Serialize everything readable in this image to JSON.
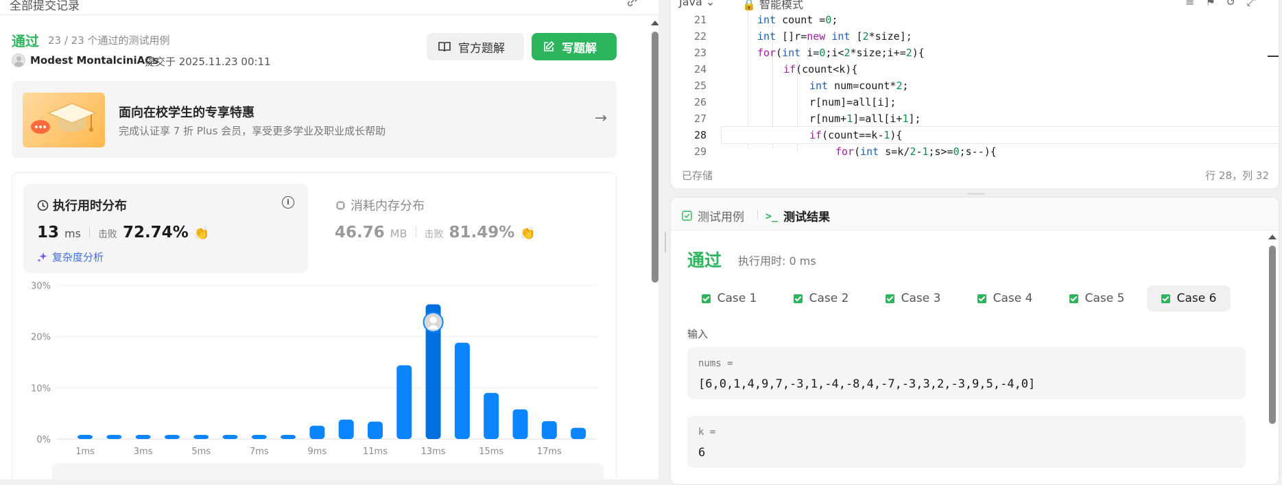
{
  "left_panel": {
    "header_title": "全部提交记录",
    "status": "通过",
    "cases_passed": "23 / 23 个通过的测试用例",
    "user": "Modest MontalciniACs",
    "submit_time": "提交于 2025.11.23 00:11",
    "btn_official": "官方题解",
    "btn_write": "写题解",
    "promo_title": "面向在校学生的专享特惠",
    "promo_sub": "完成认证享 7 折 Plus 会员，享受更多学业及职业成长帮助",
    "runtime_title": "执行用时分布",
    "runtime_value": "13",
    "runtime_unit": "ms",
    "beat_label": "击败",
    "runtime_pct": "72.74%",
    "complexity": "复杂度分析",
    "memory_title": "消耗内存分布",
    "memory_value": "46.76",
    "memory_unit": "MB",
    "memory_pct": "81.49%"
  },
  "chart_data": {
    "type": "bar",
    "categories": [
      "1ms",
      "2ms",
      "3ms",
      "4ms",
      "5ms",
      "6ms",
      "7ms",
      "8ms",
      "9ms",
      "10ms",
      "11ms",
      "12ms",
      "13ms",
      "14ms",
      "15ms",
      "16ms",
      "17ms",
      "18ms"
    ],
    "tick_labels": [
      "1ms",
      "3ms",
      "5ms",
      "7ms",
      "9ms",
      "11ms",
      "13ms",
      "15ms",
      "17ms"
    ],
    "values": [
      0.8,
      0.8,
      0.8,
      0.8,
      0.8,
      0.8,
      0.8,
      0.8,
      2.6,
      3.8,
      3.4,
      14.4,
      26.3,
      18.8,
      9.0,
      5.8,
      3.5,
      2.2
    ],
    "highlight_category": "13ms",
    "yticks": [
      "0%",
      "10%",
      "20%",
      "30%"
    ],
    "ylim": [
      0,
      30
    ],
    "grid": true,
    "colors": {
      "bar": "#0a84ff",
      "highlight": "#0070e0"
    }
  },
  "editor": {
    "language": "Java",
    "mode": "智能模式",
    "saved": "已存储",
    "cursor": "行 28，列 32",
    "lines": [
      {
        "n": "21",
        "html": "<span class=\"ty\">int</span> count =<span class=\"nm\">0</span>;",
        "indent": 2
      },
      {
        "n": "22",
        "html": "<span class=\"ty\">int</span> []r=<span class=\"kw\">new</span> <span class=\"ty\">int</span> [<span class=\"nm\">2</span>*size];",
        "indent": 2
      },
      {
        "n": "23",
        "html": "<span class=\"kw\">for</span>(<span class=\"ty\">int</span> i=<span class=\"nm\">0</span>;i&lt;<span class=\"nm\">2</span>*size;i+=<span class=\"nm\">2</span>){",
        "indent": 2
      },
      {
        "n": "24",
        "html": "<span class=\"kw\">if</span>(count&lt;k){",
        "indent": 3
      },
      {
        "n": "25",
        "html": "<span class=\"ty\">int</span> num=count*<span class=\"nm\">2</span>;",
        "indent": 4
      },
      {
        "n": "26",
        "html": "r[num]=all[i];",
        "indent": 4
      },
      {
        "n": "27",
        "html": "r[num+<span class=\"nm\">1</span>]=all[i+<span class=\"nm\">1</span>];",
        "indent": 4
      },
      {
        "n": "28",
        "html": "<span class=\"kw\">if</span>(count==k-<span class=\"nm\">1</span>){",
        "indent": 4,
        "active": true
      },
      {
        "n": "29",
        "html": "<span class=\"kw\">for</span>(<span class=\"ty\">int</span> s=k/<span class=\"nm\">2</span>-<span class=\"nm\">1</span>;s&gt;=<span class=\"nm\">0</span>;s--){",
        "indent": 5
      }
    ]
  },
  "results": {
    "tab_cases": "测试用例",
    "tab_results": "测试结果",
    "status": "通过",
    "exec_time": "执行用时: 0 ms",
    "cases": [
      "Case 1",
      "Case 2",
      "Case 3",
      "Case 4",
      "Case 5",
      "Case 6"
    ],
    "selected_case": 5,
    "input_label": "输入",
    "field1_name": "nums =",
    "field1_value": "[6,0,1,4,9,7,-3,1,-4,-8,4,-7,-3,3,2,-3,9,5,-4,0]",
    "field2_name": "k =",
    "field2_value": "6"
  }
}
